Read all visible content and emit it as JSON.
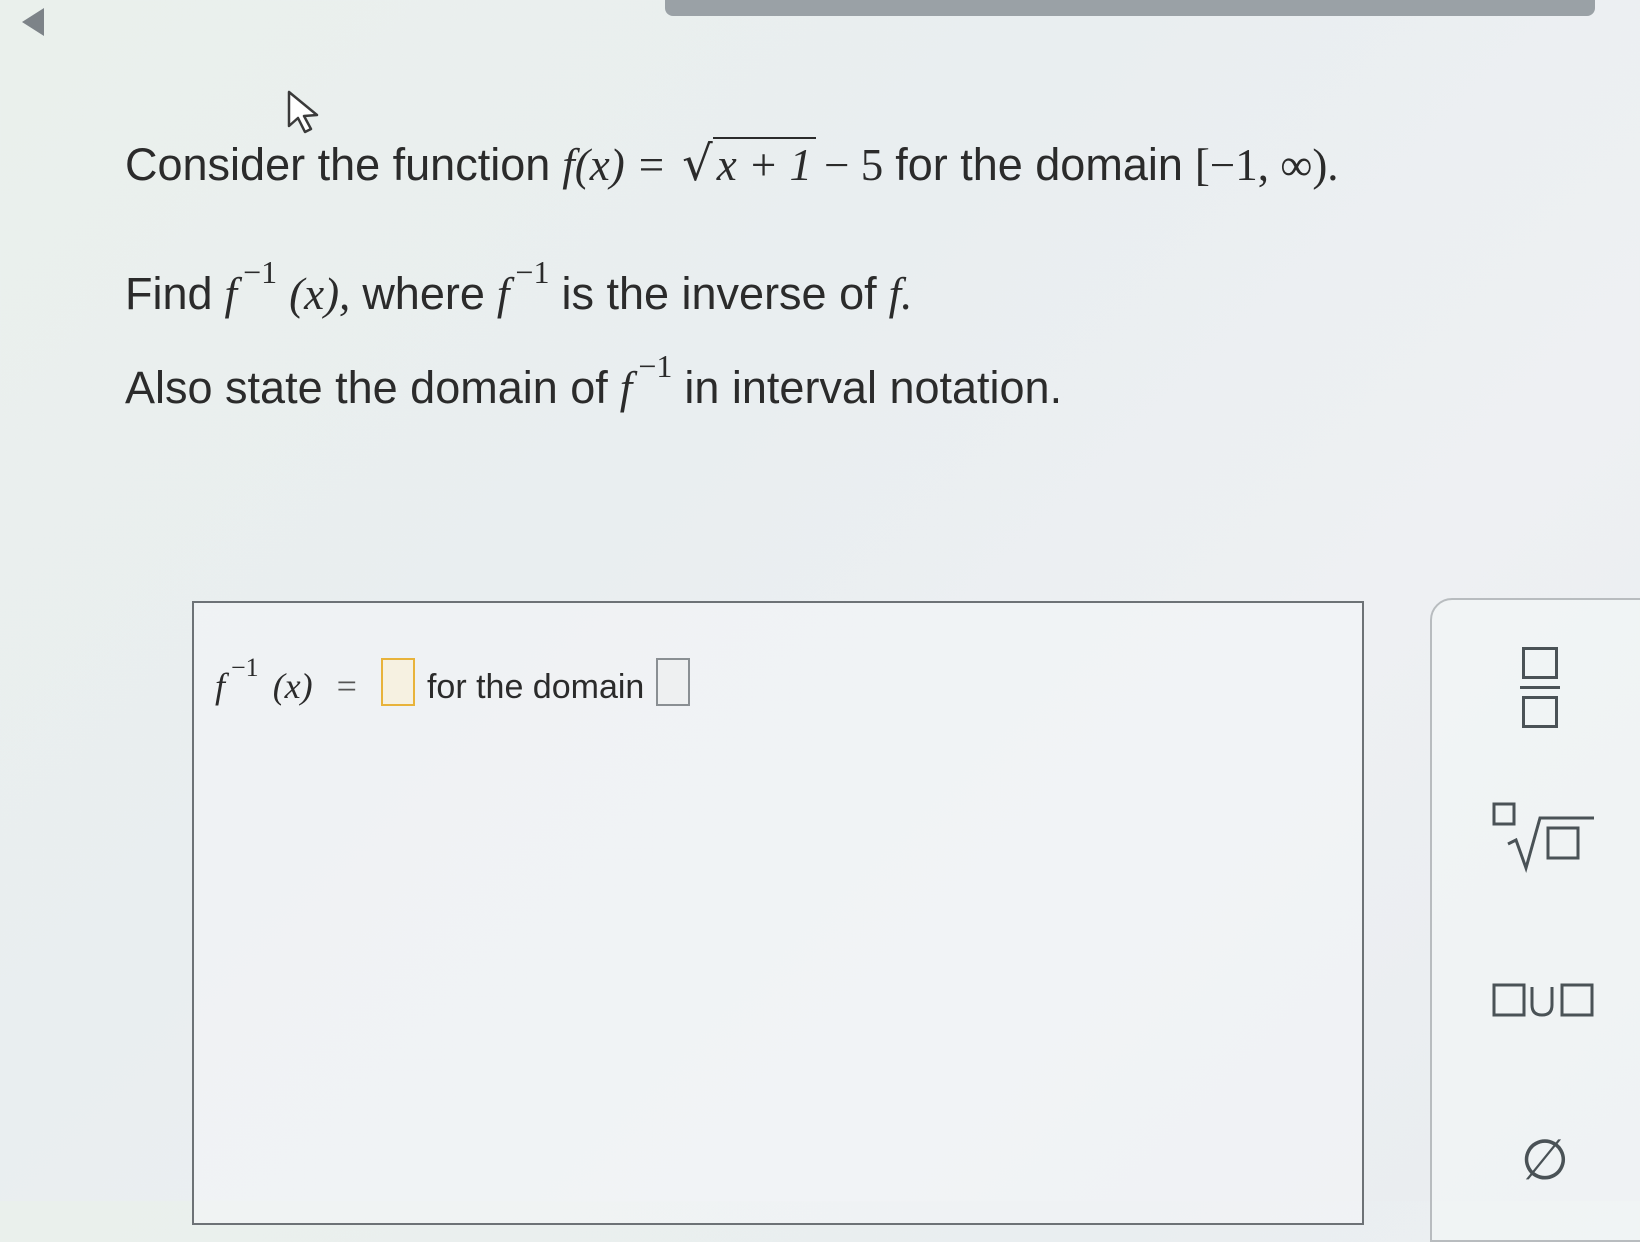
{
  "problem": {
    "line1": {
      "prefix": "Consider the function",
      "f": "f",
      "x_paren": "(x)",
      "equals": "=",
      "radicand": "x + 1",
      "minus5": "− 5",
      "domain_text": "for the domain",
      "interval": "[−1, ∞)."
    },
    "line2": {
      "find": "Find",
      "f": "f",
      "sup": "−1",
      "x_paren": "(x),",
      "where": "where",
      "f2": "f",
      "sup2": "−1",
      "rest": "is the inverse of",
      "f3": "f."
    },
    "line3": {
      "prefix": "Also state the domain of",
      "f": "f",
      "sup": "−1",
      "rest": "in interval notation."
    }
  },
  "answer": {
    "f": "f",
    "sup": "−1",
    "x_paren": "(x)",
    "equals": "=",
    "domain_text": "for the domain"
  },
  "tools": {
    "fraction": "fraction-tool",
    "root": "nth-root-tool",
    "union": "union-tool",
    "empty_set_symbol": "∅"
  }
}
